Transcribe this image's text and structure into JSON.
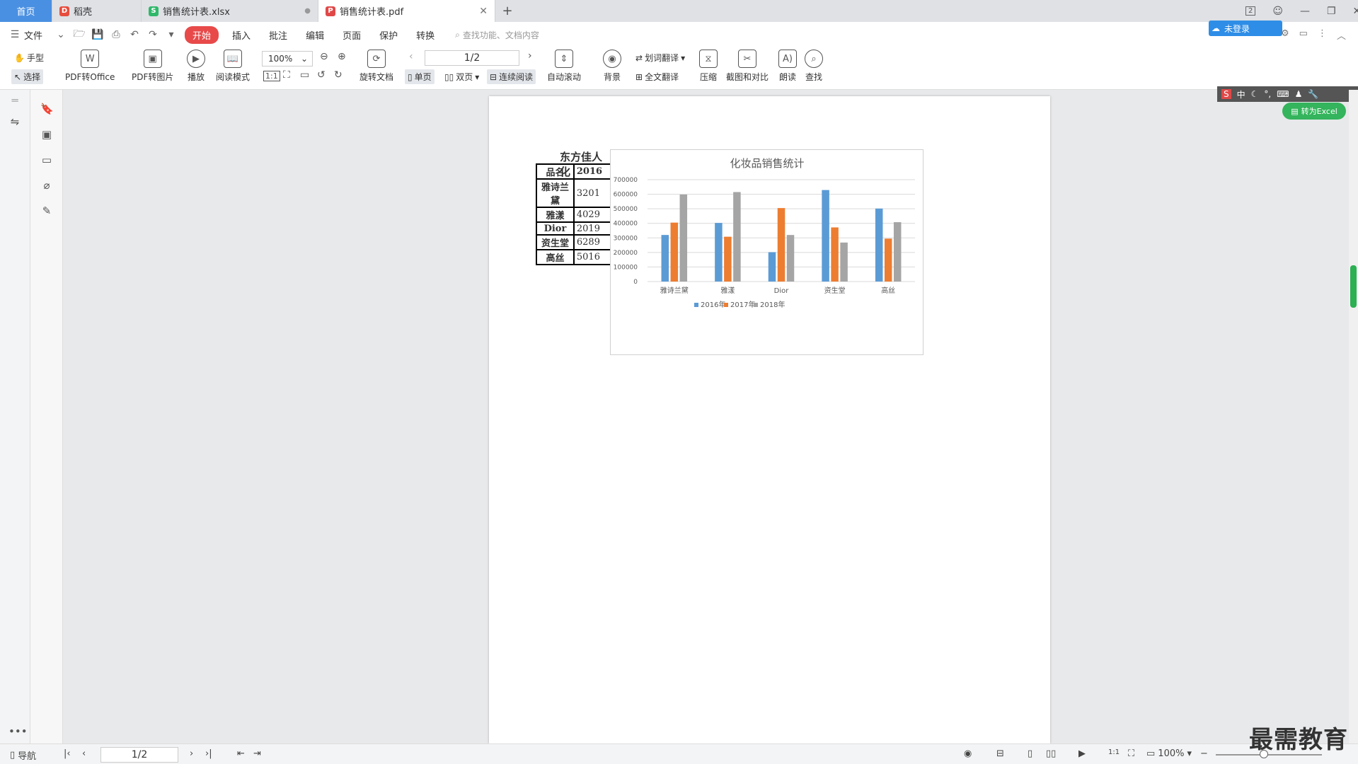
{
  "tabs": [
    {
      "label": "首页"
    },
    {
      "label": "稻壳"
    },
    {
      "label": "销售统计表.xlsx"
    },
    {
      "label": "销售统计表.pdf"
    }
  ],
  "window_badge": "2",
  "menu": {
    "file": "文件",
    "items": [
      "开始",
      "插入",
      "批注",
      "编辑",
      "页面",
      "保护",
      "转换"
    ],
    "search_placeholder": "查找功能、文档内容",
    "login": "未登录"
  },
  "toolbar": {
    "hand": "手型",
    "select": "选择",
    "pdf_to_office": "PDF转Office",
    "pdf_to_image": "PDF转图片",
    "play": "播放",
    "read_mode": "阅读模式",
    "zoom": "100%",
    "rotate_doc": "旋转文档",
    "page": "1/2",
    "single": "单页",
    "double": "双页",
    "continuous": "连续阅读",
    "auto_scroll": "自动滚动",
    "background": "背景",
    "word_translate": "划词翻译",
    "full_translate": "全文翻译",
    "compress": "压缩",
    "screenshot_compare": "截图和对比",
    "read_aloud": "朗读",
    "find": "查找"
  },
  "ime": {
    "lang": "中"
  },
  "to_excel": "转为Excel",
  "table": {
    "title": "东方佳人化",
    "header": [
      "品名",
      "2016"
    ],
    "rows": [
      [
        "雅诗兰黛",
        "3201"
      ],
      [
        "雅漾",
        "4029"
      ],
      [
        "Dior",
        "2019"
      ],
      [
        "资生堂",
        "6289"
      ],
      [
        "高丝",
        "5016"
      ]
    ]
  },
  "chart_data": {
    "type": "bar",
    "title": "化妆品销售统计",
    "categories": [
      "雅诗兰黛",
      "雅漾",
      "Dior",
      "资生堂",
      "高丝"
    ],
    "series": [
      {
        "name": "2016年",
        "color": "#5b9bd5",
        "values": [
          320100,
          402900,
          201900,
          628900,
          501600
        ]
      },
      {
        "name": "2017年",
        "color": "#ed7d31",
        "values": [
          405000,
          308000,
          505000,
          372000,
          295000
        ]
      },
      {
        "name": "2018年",
        "color": "#a5a5a5",
        "values": [
          598000,
          615000,
          320000,
          268000,
          408000
        ]
      }
    ],
    "ylim": [
      0,
      700000
    ],
    "yticks": [
      "0",
      "100000",
      "200000",
      "300000",
      "400000",
      "500000",
      "600000",
      "700000"
    ],
    "grid": true,
    "legend": "bottom"
  },
  "status": {
    "nav": "导航",
    "page": "1/2",
    "zoom": "100%"
  },
  "watermark": "最需教育"
}
